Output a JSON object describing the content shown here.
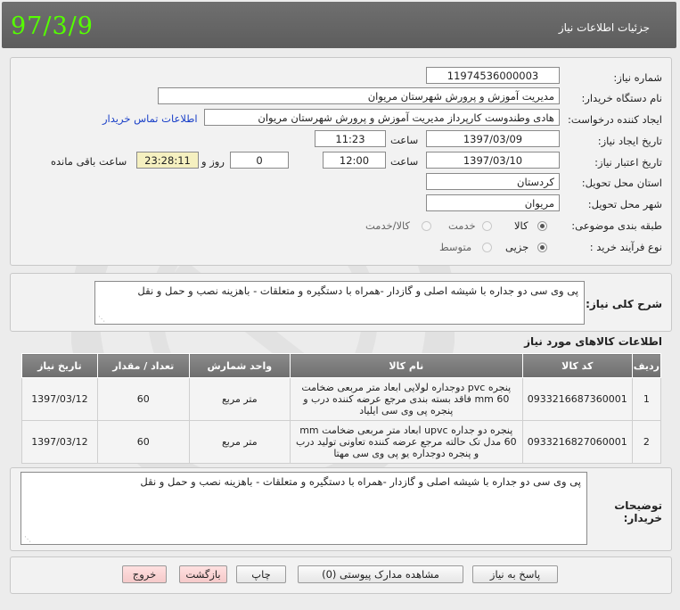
{
  "header": {
    "title": "جزئیات اطلاعات نیاز",
    "date": "97/3/9"
  },
  "form": {
    "need_number_label": "شماره نیاز:",
    "need_number": "11974536000003",
    "buyer_org_label": "نام دستگاه خریدار:",
    "buyer_org": "مدیریت آموزش و پرورش شهرستان مریوان",
    "requester_label": "ایجاد کننده درخواست:",
    "requester": "هادی وطندوست کارپرداز مدیریت آموزش و پرورش شهرستان مریوان",
    "contact_link": "اطلاعات تماس خریدار",
    "created_label": "تاریخ ایجاد نیاز:",
    "created_date": "1397/03/09",
    "time_label": "ساعت",
    "created_time": "11:23",
    "validity_label": "تاریخ اعتبار نیاز:",
    "validity_date": "1397/03/10",
    "validity_time": "12:00",
    "days_value": "0",
    "days_label": "روز و",
    "remaining_time": "23:28:11",
    "remaining_label": "ساعت باقی مانده",
    "province_label": "استان محل تحویل:",
    "province": "کردستان",
    "city_label": "شهر محل تحویل:",
    "city": "مریوان",
    "category_label": "طبقه بندی موضوعی:",
    "category_options": [
      "کالا",
      "خدمت",
      "کالا/خدمت"
    ],
    "process_label": "نوع فرآیند خرید :",
    "process_options": [
      "جزیی",
      "متوسط"
    ]
  },
  "summary": {
    "label": "شرح کلی نیاز:",
    "text": "پی وی سی دو جداره با شیشه اصلی و گازدار -همراه با دستگیره و متعلقات - باهزینه نصب و حمل و نقل"
  },
  "goods": {
    "title": "اطلاعات کالاهای مورد نیاز",
    "headers": [
      "ردیف",
      "کد کالا",
      "نام کالا",
      "واحد شمارش",
      "تعداد / مقدار",
      "تاریخ نیاز"
    ],
    "rows": [
      {
        "row": "1",
        "code": "0933216687360001",
        "name": "پنجره pvc دوجداره لولایی ابعاد متر مربعی ضخامت mm 60 فاقد بسته بندی مرجع عرضه کننده درب و پنجره پی وی سی ایلیاد",
        "unit": "متر مربع",
        "qty": "60",
        "date": "1397/03/12"
      },
      {
        "row": "2",
        "code": "0933216827060001",
        "name": "پنجره دو جداره upvc ابعاد متر مربعی ضخامت mm 60 مدل تک حالته مرجع عرضه کننده تعاونی تولید درب و پنجره دوجداره یو پی وی سی مهتا",
        "unit": "متر مربع",
        "qty": "60",
        "date": "1397/03/12"
      }
    ]
  },
  "buyer_notes": {
    "label_line1": "توضیحات",
    "label_line2": "خریدار:",
    "text": "پی وی سی دو جداره با شیشه اصلی و گازدار -همراه با دستگیره و متعلقات - باهزینه نصب و حمل و نقل"
  },
  "buttons": {
    "reply": "پاسخ به نیاز",
    "attachments": "مشاهده مدارک پیوستی (0)",
    "print": "چاپ",
    "back": "بازگشت",
    "exit": "خروج"
  },
  "colors": {
    "header_bg": "#666666",
    "date_green": "#55ff00",
    "remaining_bg": "#f5f0c0",
    "link": "#1a40c8"
  }
}
